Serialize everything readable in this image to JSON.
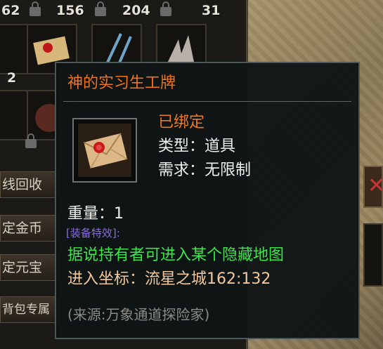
{
  "inventory": {
    "counts": [
      "62",
      "156",
      "204",
      "31",
      "2"
    ],
    "side_buttons": [
      "线回收",
      "定金币",
      "定元宝",
      "背包专属"
    ]
  },
  "tooltip": {
    "item_name": "神的实习生工牌",
    "bound": "已绑定",
    "type_line": "类型：道具",
    "requirement_line": "需求：无限制",
    "weight_line": "重量：1",
    "effect_header": "[装备特效]:",
    "description": "据说持有者可进入某个隐藏地图",
    "coordinate_line": "进入坐标：流星之城162:132",
    "source": "(来源:万象通道探险家)"
  },
  "colors": {
    "title": "#f0731e",
    "bound": "#f07a22",
    "effect": "#8a6ddc",
    "description": "#3fe34c",
    "coordinate": "#f2c89f",
    "source": "#8b8b86"
  },
  "icons": [
    "lock-icon",
    "letter-seal-icon",
    "close-icon"
  ]
}
